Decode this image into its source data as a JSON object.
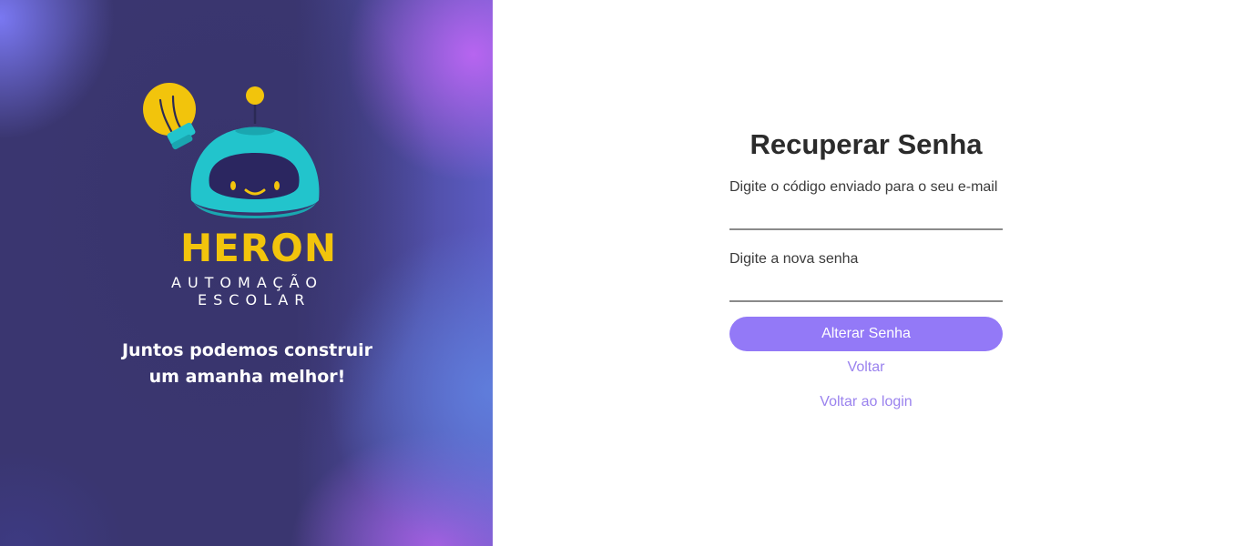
{
  "brand": {
    "name": "HERON",
    "subtitle_line1": "AUTOMAÇÃO",
    "subtitle_line2": "ESCOLAR",
    "tagline_line1": "Juntos podemos construir",
    "tagline_line2": "um amanha melhor!",
    "icons": [
      "lightbulb-icon",
      "robot-mascot-icon"
    ],
    "colors": {
      "brand_yellow": "#f2c40c",
      "robot_teal": "#22c4cc",
      "panel_dark": "#3a3670"
    }
  },
  "form": {
    "title": "Recuperar Senha",
    "code_label": "Digite o código enviado para o seu e-mail",
    "code_value": "",
    "password_label": "Digite a nova senha",
    "password_value": "",
    "submit_label": "Alterar Senha",
    "back_label": "Voltar",
    "login_label": "Voltar ao login",
    "colors": {
      "accent": "#9379f7",
      "link": "#9a82ee"
    }
  }
}
